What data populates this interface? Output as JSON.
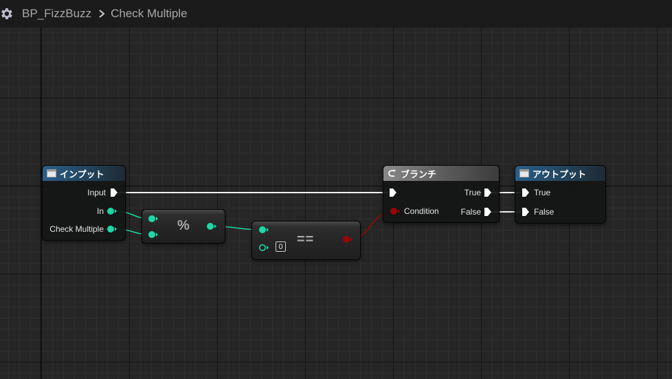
{
  "breadcrumb": {
    "blueprint": "BP_FizzBuzz",
    "graph": "Check Multiple"
  },
  "colors": {
    "integer_pin": "#1bd9a5",
    "boolean_pin": "#9a0606",
    "exec_pin": "#ffffff",
    "function_header": "#2a5f8a",
    "branch_header": "#8a8a8a"
  },
  "nodes": {
    "input": {
      "title": "インプット",
      "pins": {
        "exec": "Input",
        "in": "In",
        "check_multiple": "Check Multiple"
      }
    },
    "modulo": {
      "symbol": "%"
    },
    "equal": {
      "symbol": "==",
      "literal": "0"
    },
    "branch": {
      "title": "ブランチ",
      "pins": {
        "condition": "Condition",
        "true": "True",
        "false": "False"
      }
    },
    "output": {
      "title": "アウトプット",
      "pins": {
        "true": "True",
        "false": "False"
      }
    }
  }
}
